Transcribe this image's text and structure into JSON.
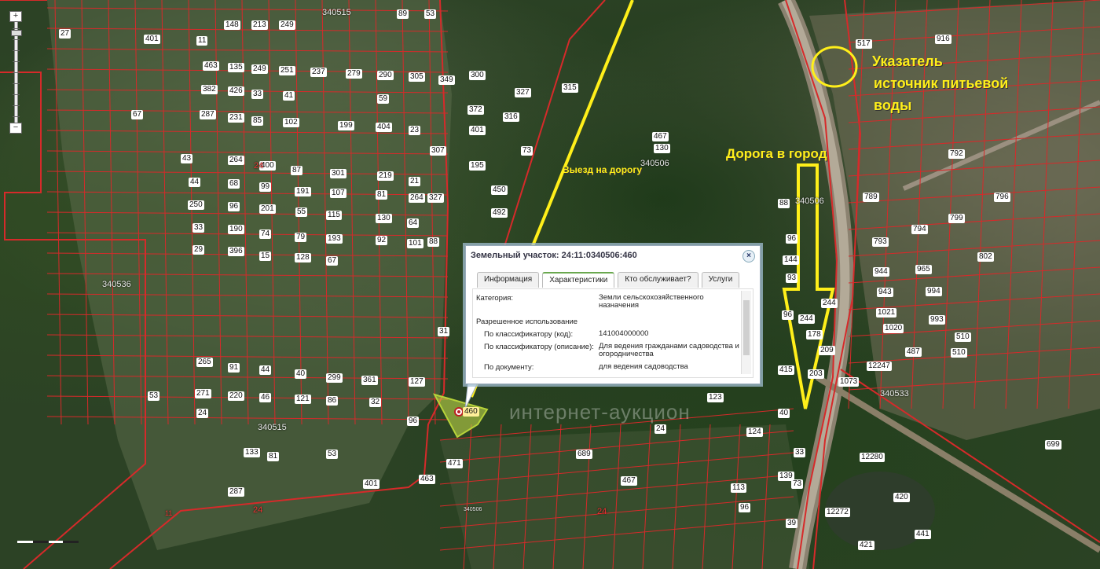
{
  "map": {
    "quarters": [
      {
        "id": "q1",
        "label": "340515"
      },
      {
        "id": "q2",
        "label": "340506"
      },
      {
        "id": "q3",
        "label": "340506"
      },
      {
        "id": "q4",
        "label": "340506"
      },
      {
        "id": "q5",
        "label": "340536"
      },
      {
        "id": "q6",
        "label": "340515"
      },
      {
        "id": "q7",
        "label": "340533"
      }
    ],
    "other_labels": [
      {
        "id": "l24a",
        "label": "24"
      },
      {
        "id": "l24b",
        "label": "24"
      },
      {
        "id": "l24c",
        "label": "24"
      },
      {
        "id": "l11",
        "label": "11"
      }
    ],
    "plots": [
      "27",
      "401",
      "11",
      "148",
      "213",
      "249",
      "89",
      "53",
      "463",
      "135",
      "249",
      "251",
      "237",
      "279",
      "290",
      "305",
      "349",
      "300",
      "327",
      "315",
      "382",
      "426",
      "33",
      "41",
      "59",
      "372",
      "401",
      "316",
      "67",
      "287",
      "231",
      "85",
      "102",
      "199",
      "404",
      "23",
      "307",
      "195",
      "73",
      "43",
      "264",
      "400",
      "87",
      "301",
      "219",
      "21",
      "327",
      "450",
      "492",
      "44",
      "68",
      "99",
      "191",
      "107",
      "81",
      "264",
      "250",
      "96",
      "201",
      "55",
      "115",
      "130",
      "64",
      "88",
      "33",
      "190",
      "74",
      "79",
      "193",
      "92",
      "101",
      "29",
      "396",
      "15",
      "128",
      "67",
      "31",
      "265",
      "91",
      "44",
      "40",
      "299",
      "361",
      "127",
      "271",
      "220",
      "46",
      "121",
      "86",
      "32",
      "96",
      "24",
      "133",
      "81",
      "287",
      "53",
      "53",
      "401",
      "463",
      "471",
      "689",
      "24",
      "467",
      "130",
      "123",
      "124",
      "113",
      "96",
      "139",
      "39",
      "40",
      "33",
      "96",
      "93",
      "73",
      "1021",
      "1020",
      "943",
      "944",
      "965",
      "994",
      "993",
      "802",
      "796",
      "789",
      "793",
      "794",
      "792",
      "799",
      "517",
      "916",
      "487",
      "510",
      "510",
      "420",
      "441",
      "421",
      "699",
      "12280",
      "12272",
      "12247",
      "1073",
      "415",
      "467",
      "88",
      "96",
      "144",
      "178",
      "203",
      "209",
      "244",
      "244"
    ],
    "selected_plot": "460"
  },
  "annotations": {
    "source_title": "Указатель",
    "source_line2": "источник питьевой",
    "source_line3": "воды",
    "road_city": "Дорога в город",
    "exit_road": "Выезд на дорогу"
  },
  "popup": {
    "title": "Земельный участок: 24:11:0340506:460",
    "tabs": [
      "Информация",
      "Характеристики",
      "Кто обслуживает?",
      "Услуги"
    ],
    "active_tab": 1,
    "category_key": "Категория:",
    "category_val": "Земли сельскохозяйственного назначения",
    "permitted_use": "Разрешенное использование",
    "code_key": "По классификатору (код):",
    "code_val": "141004000000",
    "desc_key": "По классификатору (описание):",
    "desc_val": "Для ведения гражданами садоводства и огородничества",
    "doc_key": "По документу:",
    "doc_val": "для ведения садоводства"
  },
  "watermark": "интернет-аукцион",
  "zoom": {
    "plus": "+",
    "minus": "−"
  },
  "colors": {
    "boundary": "#d62a2a",
    "annotation": "#ffef1a",
    "selected": "#cbe34a"
  }
}
